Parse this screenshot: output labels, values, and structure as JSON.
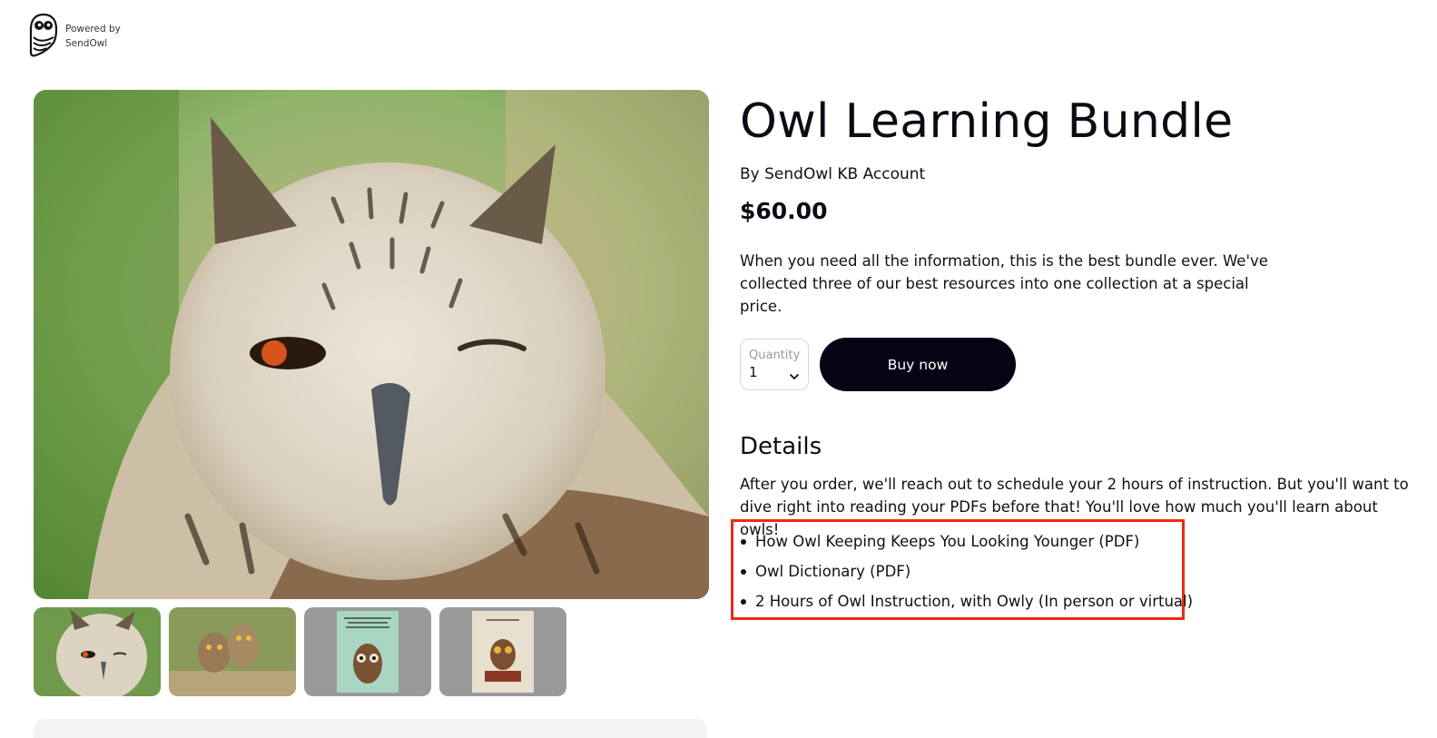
{
  "brand": {
    "powered_by": "Powered by",
    "name": "SendOwl",
    "logo_icon": "owl-logo-icon"
  },
  "product": {
    "title": "Owl Learning Bundle",
    "author": "By SendOwl KB Account",
    "price": "$60.00",
    "description": "When you need all the information, this is the best bundle ever. We've collected three of our best resources into one collection at a special price."
  },
  "purchase": {
    "quantity_label": "Quantity",
    "quantity_value": "1",
    "buy_label": "Buy now"
  },
  "details": {
    "heading": "Details",
    "text": "After you order, we'll reach out to schedule your 2 hours of instruction. But you'll want to dive right into reading your PDFs before that! You'll love how much you'll learn about owls!",
    "items": [
      "How Owl Keeping Keeps You Looking Younger (PDF)",
      "Owl Dictionary (PDF)",
      "2 Hours of Owl Instruction, with Owly (In person or virtual)"
    ]
  },
  "thumbnails": [
    {
      "name": "winking-owl"
    },
    {
      "name": "owlets"
    },
    {
      "name": "book-cover-owl-keeping",
      "caption": "Why Owl Keeping Keeps You Looking Younger"
    },
    {
      "name": "book-cover-owl-dictionary",
      "caption": "Owl Dictionary"
    }
  ],
  "colors": {
    "accent_dark": "#050516",
    "highlight_red": "#ee2a12"
  }
}
